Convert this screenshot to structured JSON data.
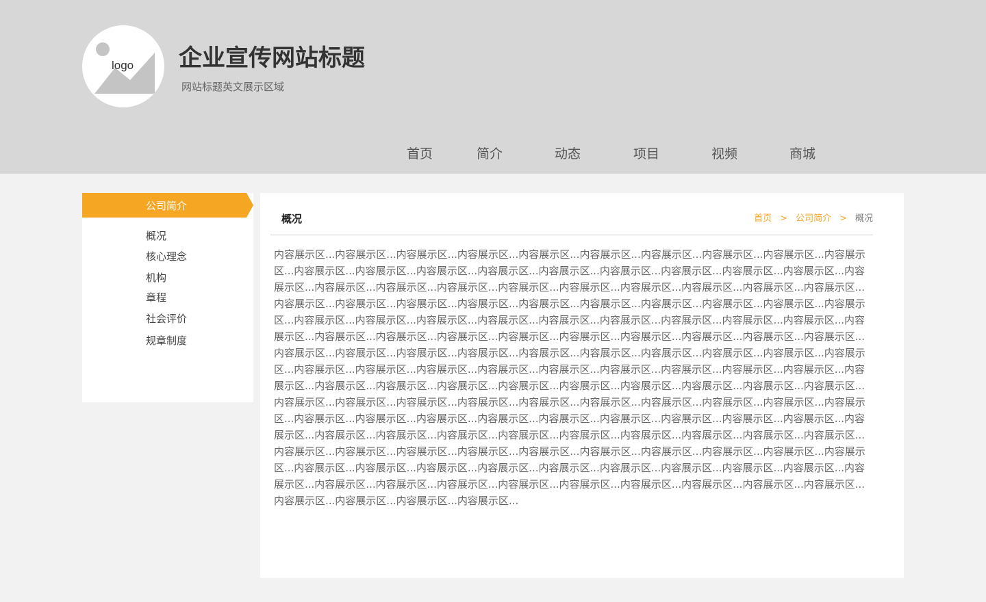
{
  "header": {
    "logo_text": "logo",
    "title": "企业宣传网站标题",
    "subtitle": "网站标题英文展示区域",
    "nav": [
      "首页",
      "简介",
      "动态",
      "项目",
      "视频",
      "商城"
    ]
  },
  "sidebar": {
    "heading": "公司简介",
    "items": [
      "概况",
      "核心理念",
      "机构",
      "章程",
      "社会评价",
      "规章制度"
    ]
  },
  "main": {
    "title": "概况",
    "breadcrumb": [
      "首页",
      "公司简介",
      "概况"
    ],
    "breadcrumb_separator": ">",
    "content": "内容展示区...内容展示区...内容展示区...内容展示区...内容展示区...内容展示区...内容展示区...内容展示区...内容展示区...内容展示区...内容展示区...内容展示区...内容展示区...内容展示区...内容展示区...内容展示区...内容展示区...内容展示区...内容展示区...内容展示区...内容展示区...内容展示区...内容展示区...内容展示区...内容展示区...内容展示区...内容展示区...内容展示区...内容展示区...内容展示区...内容展示区...内容展示区...内容展示区...内容展示区...内容展示区...内容展示区...内容展示区...内容展示区...内容展示区...内容展示区...内容展示区...内容展示区...内容展示区...内容展示区...内容展示区...内容展示区...内容展示区...内容展示区...内容展示区...内容展示区...内容展示区...内容展示区...内容展示区...内容展示区...内容展示区...内容展示区...内容展示区...内容展示区...内容展示区...内容展示区...内容展示区...内容展示区...内容展示区...内容展示区...内容展示区...内容展示区...内容展示区...内容展示区...内容展示区...内容展示区...内容展示区...内容展示区...内容展示区...内容展示区...内容展示区...内容展示区...内容展示区...内容展示区...内容展示区...内容展示区...内容展示区...内容展示区...内容展示区...内容展示区...内容展示区...内容展示区...内容展示区...内容展示区...内容展示区...内容展示区...内容展示区...内容展示区...内容展示区...内容展示区...内容展示区...内容展示区...内容展示区...内容展示区...内容展示区...内容展示区...内容展示区...内容展示区...内容展示区...内容展示区...内容展示区...内容展示区...内容展示区...内容展示区...内容展示区...内容展示区...内容展示区...内容展示区...内容展示区...内容展示区...内容展示区...内容展示区...内容展示区...内容展示区...内容展示区...内容展示区...内容展示区...内容展示区...内容展示区...内容展示区...内容展示区...内容展示区...内容展示区...内容展示区...内容展示区...内容展示区...内容展示区...内容展示区...内容展示区...内容展示区...内容展示区...内容展示区...内容展示区...内容展示区...内容展示区...内容展示区...内容展示区...内容展示区...内容展示区...内容展示区...内容展示区...内容展示区...内容展示区...内容展示区...内容展示区..."
  },
  "colors": {
    "accent": "#f5a623",
    "header_bg": "#d7d7d7",
    "page_bg": "#f2f2f2",
    "panel_bg": "#ffffff"
  }
}
